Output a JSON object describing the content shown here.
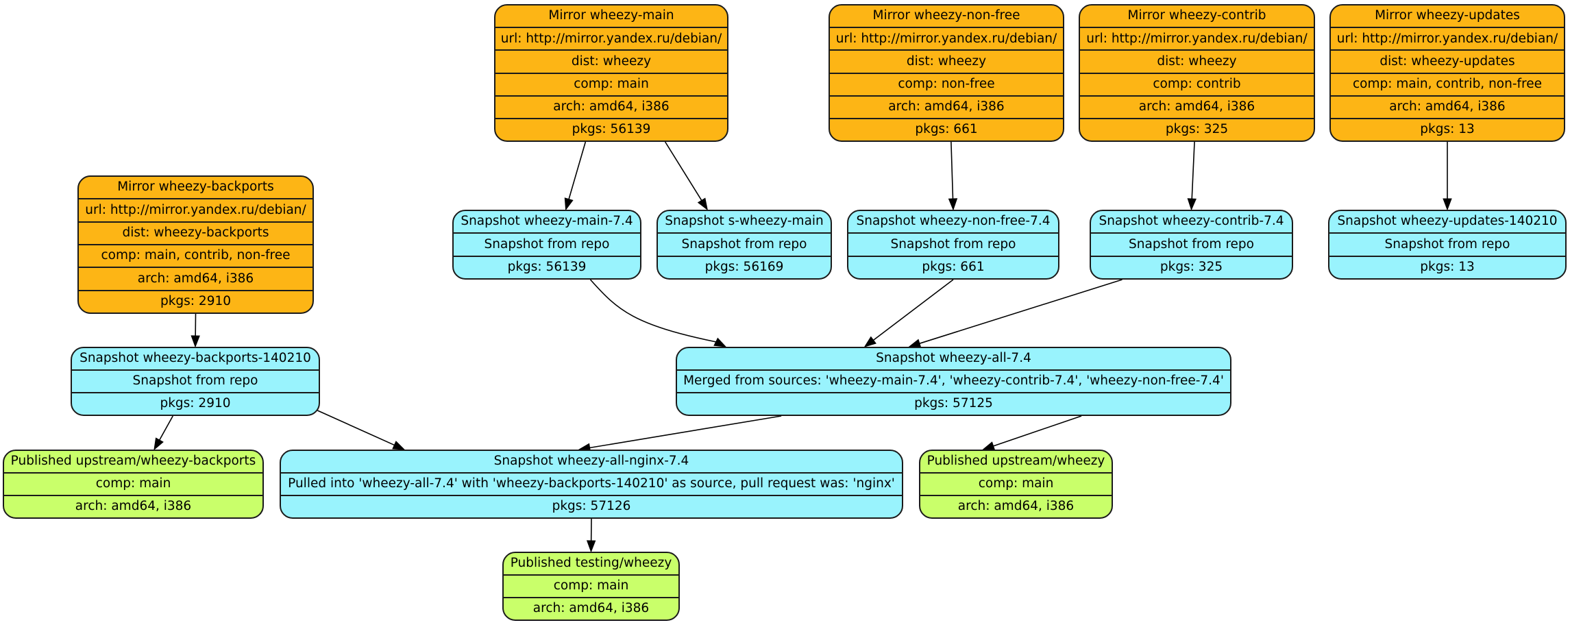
{
  "diagram": {
    "type": "graph",
    "colors": {
      "mirror": "#fdb515",
      "snapshot": "#99f3fd",
      "published": "#c9ff6a",
      "border": "#1a1a1a",
      "edge": "#000000"
    },
    "nodes": [
      {
        "id": "mirror-wheezy-main",
        "kind": "mirror",
        "rows": [
          "Mirror wheezy-main",
          "url: http://mirror.yandex.ru/debian/",
          "dist: wheezy",
          "comp: main",
          "arch: amd64, i386",
          "pkgs: 56139"
        ]
      },
      {
        "id": "mirror-wheezy-non-free",
        "kind": "mirror",
        "rows": [
          "Mirror wheezy-non-free",
          "url: http://mirror.yandex.ru/debian/",
          "dist: wheezy",
          "comp: non-free",
          "arch: amd64, i386",
          "pkgs: 661"
        ]
      },
      {
        "id": "mirror-wheezy-contrib",
        "kind": "mirror",
        "rows": [
          "Mirror wheezy-contrib",
          "url: http://mirror.yandex.ru/debian/",
          "dist: wheezy",
          "comp: contrib",
          "arch: amd64, i386",
          "pkgs: 325"
        ]
      },
      {
        "id": "mirror-wheezy-updates",
        "kind": "mirror",
        "rows": [
          "Mirror wheezy-updates",
          "url: http://mirror.yandex.ru/debian/",
          "dist: wheezy-updates",
          "comp: main, contrib, non-free",
          "arch: amd64, i386",
          "pkgs: 13"
        ]
      },
      {
        "id": "mirror-wheezy-backports",
        "kind": "mirror",
        "rows": [
          "Mirror wheezy-backports",
          "url: http://mirror.yandex.ru/debian/",
          "dist: wheezy-backports",
          "comp: main, contrib, non-free",
          "arch: amd64, i386",
          "pkgs: 2910"
        ]
      },
      {
        "id": "snapshot-wheezy-main-7.4",
        "kind": "snapshot",
        "rows": [
          "Snapshot wheezy-main-7.4",
          "Snapshot from repo",
          "pkgs: 56139"
        ]
      },
      {
        "id": "snapshot-s-wheezy-main",
        "kind": "snapshot",
        "rows": [
          "Snapshot s-wheezy-main",
          "Snapshot from repo",
          "pkgs: 56169"
        ]
      },
      {
        "id": "snapshot-wheezy-non-free-7.4",
        "kind": "snapshot",
        "rows": [
          "Snapshot wheezy-non-free-7.4",
          "Snapshot from repo",
          "pkgs: 661"
        ]
      },
      {
        "id": "snapshot-wheezy-contrib-7.4",
        "kind": "snapshot",
        "rows": [
          "Snapshot wheezy-contrib-7.4",
          "Snapshot from repo",
          "pkgs: 325"
        ]
      },
      {
        "id": "snapshot-wheezy-updates-140210",
        "kind": "snapshot",
        "rows": [
          "Snapshot wheezy-updates-140210",
          "Snapshot from repo",
          "pkgs: 13"
        ]
      },
      {
        "id": "snapshot-wheezy-backports-140210",
        "kind": "snapshot",
        "rows": [
          "Snapshot wheezy-backports-140210",
          "Snapshot from repo",
          "pkgs: 2910"
        ]
      },
      {
        "id": "snapshot-wheezy-all-7.4",
        "kind": "snapshot",
        "rows": [
          "Snapshot wheezy-all-7.4",
          "Merged from sources: 'wheezy-main-7.4', 'wheezy-contrib-7.4', 'wheezy-non-free-7.4'",
          "pkgs: 57125"
        ]
      },
      {
        "id": "snapshot-wheezy-all-nginx-7.4",
        "kind": "snapshot",
        "rows": [
          "Snapshot wheezy-all-nginx-7.4",
          "Pulled into 'wheezy-all-7.4' with 'wheezy-backports-140210' as source, pull request was: 'nginx'",
          "pkgs: 57126"
        ]
      },
      {
        "id": "published-upstream-wheezy-backports",
        "kind": "published",
        "rows": [
          "Published upstream/wheezy-backports",
          "comp: main",
          "arch: amd64, i386"
        ]
      },
      {
        "id": "published-upstream-wheezy",
        "kind": "published",
        "rows": [
          "Published upstream/wheezy",
          "comp: main",
          "arch: amd64, i386"
        ]
      },
      {
        "id": "published-testing-wheezy",
        "kind": "published",
        "rows": [
          "Published testing/wheezy",
          "comp: main",
          "arch: amd64, i386"
        ]
      }
    ],
    "edges": [
      {
        "from": "mirror-wheezy-main",
        "to": "snapshot-wheezy-main-7.4"
      },
      {
        "from": "mirror-wheezy-main",
        "to": "snapshot-s-wheezy-main"
      },
      {
        "from": "mirror-wheezy-non-free",
        "to": "snapshot-wheezy-non-free-7.4"
      },
      {
        "from": "mirror-wheezy-contrib",
        "to": "snapshot-wheezy-contrib-7.4"
      },
      {
        "from": "mirror-wheezy-updates",
        "to": "snapshot-wheezy-updates-140210"
      },
      {
        "from": "mirror-wheezy-backports",
        "to": "snapshot-wheezy-backports-140210"
      },
      {
        "from": "snapshot-wheezy-main-7.4",
        "to": "snapshot-wheezy-all-7.4"
      },
      {
        "from": "snapshot-wheezy-non-free-7.4",
        "to": "snapshot-wheezy-all-7.4"
      },
      {
        "from": "snapshot-wheezy-contrib-7.4",
        "to": "snapshot-wheezy-all-7.4"
      },
      {
        "from": "snapshot-wheezy-backports-140210",
        "to": "published-upstream-wheezy-backports"
      },
      {
        "from": "snapshot-wheezy-backports-140210",
        "to": "snapshot-wheezy-all-nginx-7.4"
      },
      {
        "from": "snapshot-wheezy-all-7.4",
        "to": "snapshot-wheezy-all-nginx-7.4"
      },
      {
        "from": "snapshot-wheezy-all-7.4",
        "to": "published-upstream-wheezy"
      },
      {
        "from": "snapshot-wheezy-all-nginx-7.4",
        "to": "published-testing-wheezy"
      }
    ]
  }
}
